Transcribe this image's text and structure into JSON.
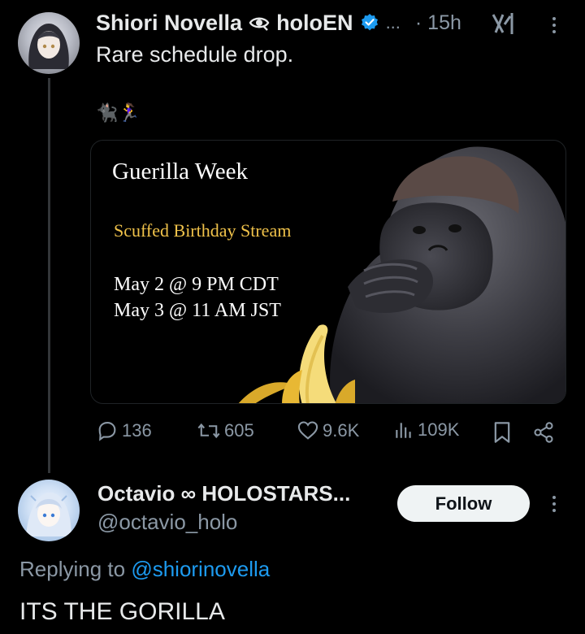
{
  "tweet": {
    "author_name": "Shiori Novella",
    "author_affiliation": "holoEN",
    "ellipsis": "...",
    "time": "· 15h",
    "text": "Rare schedule drop.",
    "emojis": "🐈‍⬛🏃‍♀️",
    "media": {
      "title": "Guerilla Week",
      "subtitle": "Scuffed Birthday Stream",
      "line1": "May 2 @ 9 PM CDT",
      "line2": "May 3 @ 11 AM JST"
    },
    "stats": {
      "replies": "136",
      "reposts": "605",
      "likes": "9.6K",
      "views": "109K"
    }
  },
  "reply": {
    "author_name": "Octavio ∞ HOLOSTARS...",
    "handle": "@octavio_holo",
    "follow_label": "Follow",
    "replying_prefix": "Replying to",
    "replying_to": "@shiorinovella",
    "text": "ITS THE GORILLA"
  },
  "colors": {
    "accent": "#1d9bf0",
    "muted": "#8b98a5",
    "text": "#e7e9ea",
    "gold": "#f0c24a"
  },
  "icons": [
    "eye-emblem-icon",
    "verified-badge-icon",
    "grok-icon",
    "more-icon",
    "reply-icon",
    "repost-icon",
    "like-icon",
    "views-icon",
    "bookmark-icon",
    "share-icon",
    "infinity-icon"
  ]
}
